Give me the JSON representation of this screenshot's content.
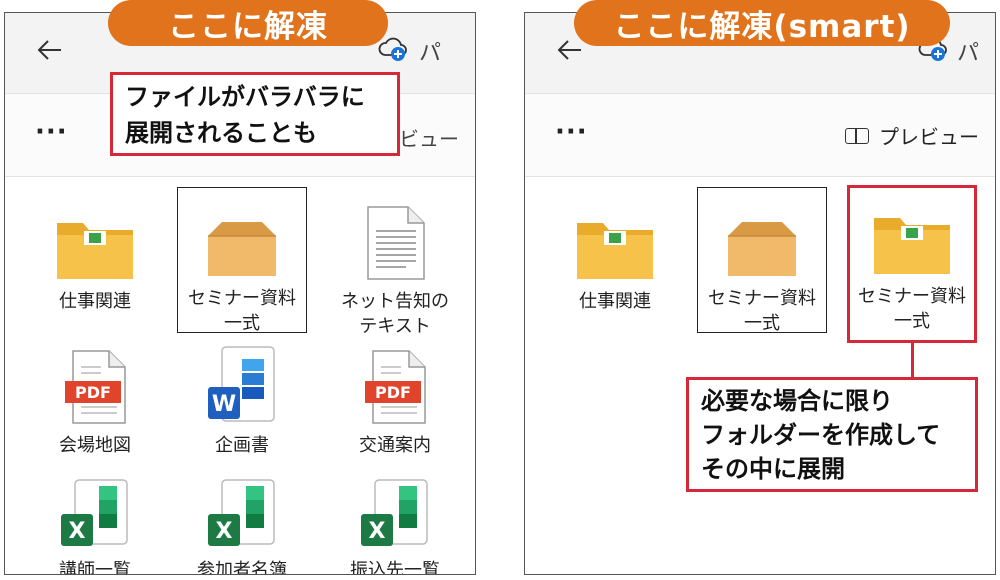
{
  "left": {
    "banner": "ここに解凍",
    "titlebar_fragment": "パ",
    "toolbar_fragment": "ビュー",
    "callout": "ファイルがバラバラに\n展開されることも",
    "files": [
      {
        "name": "仕事関連",
        "icon": "folder-icon"
      },
      {
        "name": "セミナー資料\n一式",
        "icon": "open-box-icon"
      },
      {
        "name": "ネット告知の\nテキスト",
        "icon": "text-file-icon"
      },
      {
        "name": "会場地図",
        "icon": "pdf-file-icon",
        "badge": "PDF"
      },
      {
        "name": "企画書",
        "icon": "word-file-icon",
        "badge": "W"
      },
      {
        "name": "交通案内",
        "icon": "pdf-file-icon",
        "badge": "PDF"
      },
      {
        "name": "講師一覧",
        "icon": "excel-file-icon",
        "badge": "X"
      },
      {
        "name": "参加者名簿",
        "icon": "excel-file-icon",
        "badge": "X"
      },
      {
        "name": "振込先一覧",
        "icon": "excel-file-icon",
        "badge": "X"
      }
    ]
  },
  "right": {
    "banner": "ここに解凍(smart)",
    "titlebar_fragment": "パ",
    "preview_label": "プレビュー",
    "callout": "必要な場合に限り\nフォルダーを作成して\nその中に展開",
    "files": [
      {
        "name": "仕事関連",
        "icon": "folder-icon"
      },
      {
        "name": "セミナー資料\n一式",
        "icon": "open-box-icon"
      },
      {
        "name": "セミナー資料\n一式",
        "icon": "folder-icon"
      }
    ]
  },
  "colors": {
    "banner": "#e0731c",
    "callout_border": "#d7283a",
    "folder": "#f7c24a",
    "pdf": "#e0452c",
    "word": "#1e5fbf",
    "excel": "#1e7a44"
  }
}
